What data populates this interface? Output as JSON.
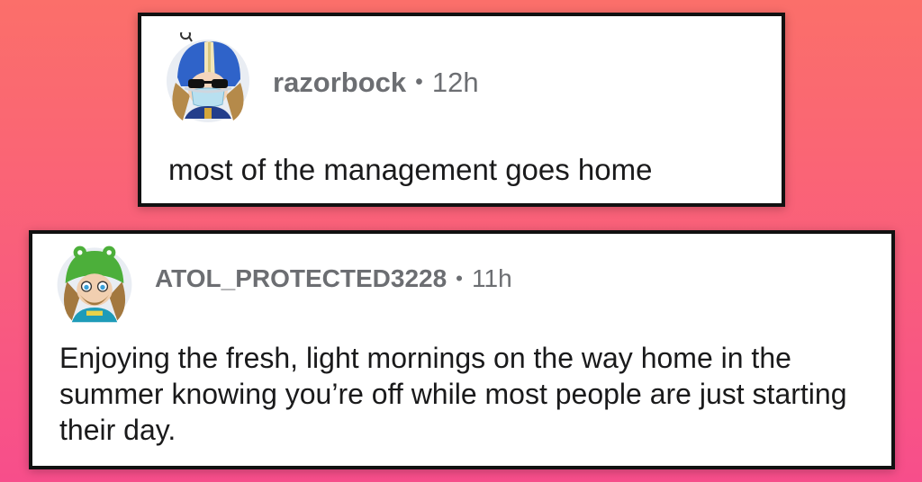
{
  "comments": [
    {
      "username": "razorbock",
      "separator": "•",
      "time": "12h",
      "body": "most of the management goes home",
      "avatar_icon": "football-helmet-avatar-icon"
    },
    {
      "username": "ATOL_PROTECTED3228",
      "separator": "•",
      "time": "11h",
      "body": "Enjoying the fresh, light mornings on the way home in the summer knowing you’re off while most people are just starting their day.",
      "avatar_icon": "frog-hat-avatar-icon"
    }
  ],
  "colors": {
    "background_top": "#fb6f6a",
    "background_bottom": "#f74e8b",
    "card": "#ffffff",
    "border": "#111111",
    "meta_text": "#6c6e72",
    "body_text": "#1a1a1b"
  }
}
